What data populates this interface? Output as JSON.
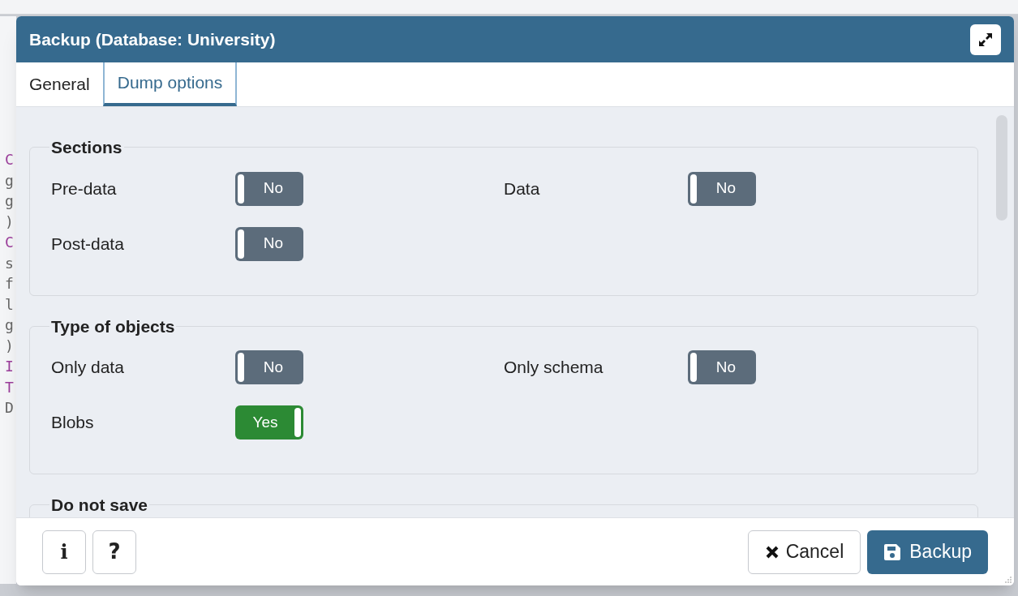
{
  "background_code": [
    {
      "text": "C",
      "kind": "keyword"
    },
    {
      "text": "g",
      "kind": "plain"
    },
    {
      "text": "g",
      "kind": "plain"
    },
    {
      "text": ")",
      "kind": "plain"
    },
    {
      "text": "C",
      "kind": "keyword"
    },
    {
      "text": "s",
      "kind": "plain"
    },
    {
      "text": "f",
      "kind": "plain"
    },
    {
      "text": "l",
      "kind": "plain"
    },
    {
      "text": "g",
      "kind": "plain"
    },
    {
      "text": ")",
      "kind": "plain"
    },
    {
      "text": "I",
      "kind": "keyword"
    },
    {
      "text": "T",
      "kind": "keyword"
    },
    {
      "text": "D",
      "kind": "plain"
    }
  ],
  "dialog": {
    "title": "Backup (Database: University)",
    "tabs": [
      {
        "label": "General",
        "selected": false
      },
      {
        "label": "Dump options",
        "selected": true
      }
    ],
    "sections": [
      {
        "title": "Sections",
        "options": [
          {
            "label": "Pre-data",
            "on": false,
            "value": "No"
          },
          {
            "label": "Data",
            "on": false,
            "value": "No"
          },
          {
            "label": "Post-data",
            "on": false,
            "value": "No"
          }
        ]
      },
      {
        "title": "Type of objects",
        "options": [
          {
            "label": "Only data",
            "on": false,
            "value": "No"
          },
          {
            "label": "Only schema",
            "on": false,
            "value": "No"
          },
          {
            "label": "Blobs",
            "on": true,
            "value": "Yes"
          }
        ]
      },
      {
        "title": "Do not save"
      }
    ],
    "footer_buttons": [
      {
        "kind": "info",
        "label": "i"
      },
      {
        "kind": "help",
        "label": "?"
      }
    ],
    "cancel": "Cancel",
    "backup": "Backup"
  }
}
